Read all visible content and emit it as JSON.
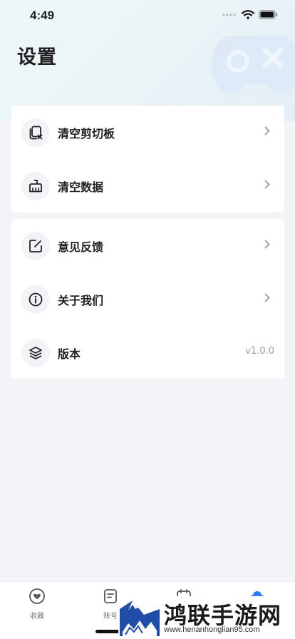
{
  "status_bar": {
    "time": "4:49"
  },
  "page": {
    "title": "设置"
  },
  "settings": {
    "group1": [
      {
        "label": "清空剪切板",
        "icon": "clipboard-clear-icon"
      },
      {
        "label": "清空数据",
        "icon": "broom-icon"
      }
    ],
    "group2": [
      {
        "label": "意见反馈",
        "icon": "edit-note-icon"
      },
      {
        "label": "关于我们",
        "icon": "info-icon"
      },
      {
        "label": "版本",
        "icon": "layers-icon",
        "value": "v1.0.0"
      }
    ]
  },
  "tabbar": {
    "tabs": [
      {
        "label": "收藏",
        "icon": "heart-icon"
      },
      {
        "label": "账号",
        "icon": "account-doc-icon"
      },
      {
        "label": "",
        "icon": "calendar-icon"
      },
      {
        "label": "",
        "icon": "settings-cloud-icon",
        "active": true
      }
    ]
  },
  "watermark": {
    "title": "鸿联手游网",
    "url": "www.henanhonglian95.com"
  },
  "colors": {
    "accent": "#2f7cf6",
    "card": "#ffffff",
    "background": "#f3f4f7"
  }
}
